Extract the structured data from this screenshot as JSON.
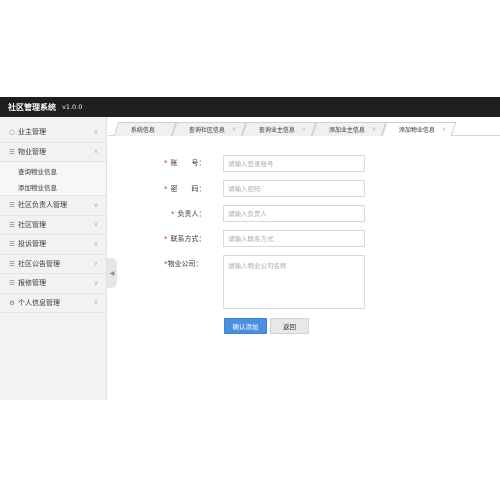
{
  "app": {
    "title": "社区管理系统",
    "version": "v1.0.0"
  },
  "sidebar": {
    "items": [
      {
        "label": "业主管理",
        "icon": "user-icon"
      },
      {
        "label": "物业管理",
        "icon": "list-icon",
        "expanded": true,
        "children": [
          "查询物业信息",
          "添加物业信息"
        ]
      },
      {
        "label": "社区负责人管理",
        "icon": "list-icon"
      },
      {
        "label": "社区管理",
        "icon": "list-icon"
      },
      {
        "label": "投诉管理",
        "icon": "list-icon"
      },
      {
        "label": "社区公告管理",
        "icon": "list-icon"
      },
      {
        "label": "报修管理",
        "icon": "list-icon"
      },
      {
        "label": "个人信息管理",
        "icon": "gear-icon"
      }
    ]
  },
  "tabs": [
    {
      "label": "系统信息",
      "closable": false
    },
    {
      "label": "查询社区信息",
      "closable": true
    },
    {
      "label": "查询业主信息",
      "closable": true
    },
    {
      "label": "添加业主信息",
      "closable": true
    },
    {
      "label": "添加物业信息",
      "closable": true,
      "active": true
    }
  ],
  "form": {
    "account": {
      "label": "账　　号：",
      "placeholder": "请输入登录账号"
    },
    "password": {
      "label": "密　　码：",
      "placeholder": "请输入密码"
    },
    "manager": {
      "label": "负责人：",
      "placeholder": "请输入负责人"
    },
    "contact": {
      "label": "联系方式：",
      "placeholder": "请输入联系方式"
    },
    "company": {
      "label": "物业公司：",
      "placeholder": "请输入物业公司名称"
    },
    "required_mark": "*",
    "submit_label": "确认添加",
    "back_label": "返回"
  },
  "colors": {
    "topbar": "#1f1f1f",
    "primary": "#4a90e2",
    "required": "#e02424"
  }
}
